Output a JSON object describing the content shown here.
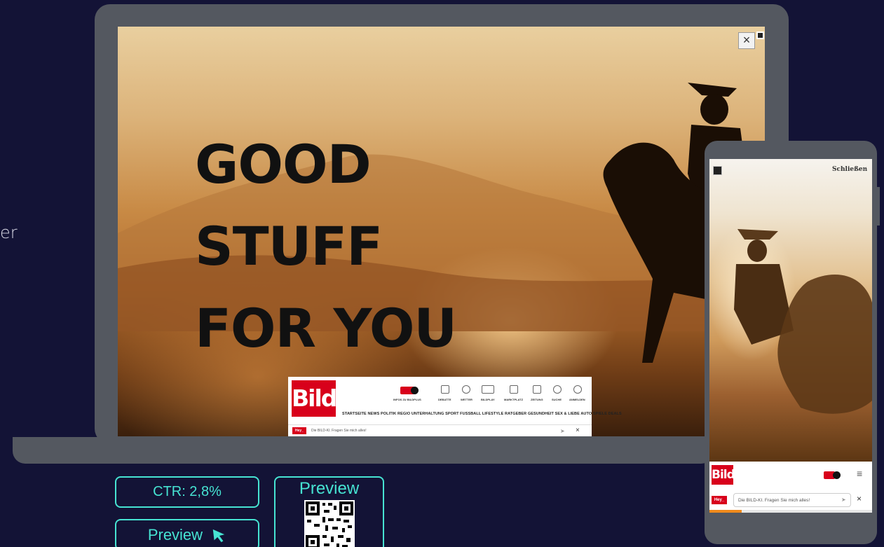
{
  "side_text": "er",
  "ad": {
    "headline": [
      "GOOD",
      "STUFF",
      "FOR YOU"
    ],
    "close_icon": "close-icon",
    "mute_icon": "mute-icon"
  },
  "bild_desktop": {
    "logo": "Bild",
    "infos_label": "INFOS ZU BILDPLUS",
    "nav_icons": [
      {
        "name": "debatte-icon",
        "label": "DEBATTE"
      },
      {
        "name": "wetter-icon",
        "label": "WETTER"
      },
      {
        "name": "bildplay-icon",
        "label": "BILDPLAY"
      },
      {
        "name": "marktplatz-icon",
        "label": "MARKTPLATZ"
      },
      {
        "name": "zeitung-icon",
        "label": "ZEITUNG"
      },
      {
        "name": "suche-icon",
        "label": "SUCHE"
      },
      {
        "name": "anmelden-icon",
        "label": "ANMELDEN"
      }
    ],
    "nav_links": "STARTSEITE NEWS POLITIK REGIO UNTERHALTUNG SPORT FUSSBALL LIFESTYLE RATGEBER GESUNDHEIT SEX & LIEBE AUTO SPIELE DEALS",
    "hey_badge": "Hey_",
    "search_placeholder": "Die BILD-KI. Fragen Sie mich alles!"
  },
  "phone": {
    "close_label": "Schließen",
    "logo": "Bild",
    "hey_badge": "Hey_",
    "search_placeholder": "Die BILD-KI. Fragen Sie mich alles!",
    "progress": 0.2
  },
  "stats": {
    "ctr_label": "CTR: 2,8%",
    "preview_button": "Preview",
    "qr_label": "Preview"
  },
  "colors": {
    "background": "#131336",
    "accent": "#46e3d2",
    "device": "#545860",
    "bild_red": "#d8001b"
  }
}
